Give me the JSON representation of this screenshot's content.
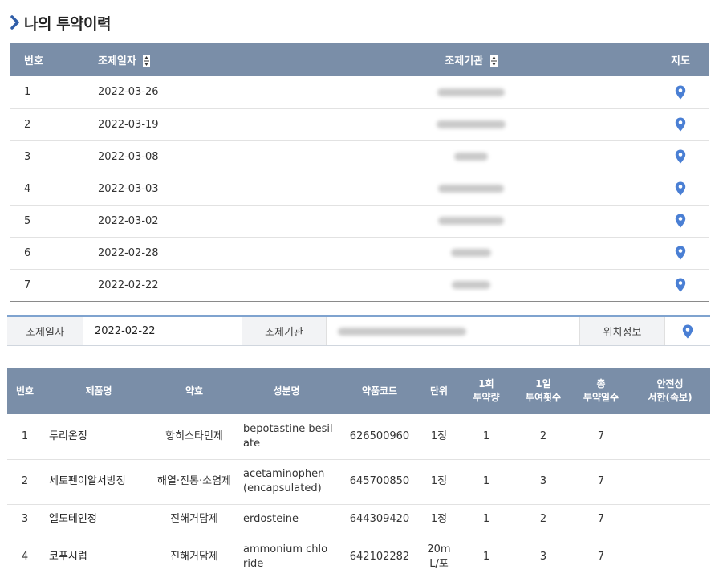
{
  "page": {
    "title": "나의 투약이력",
    "accent_color": "#7a8ea8",
    "pin_color": "#4a7fd4"
  },
  "history": {
    "headers": {
      "no": "번호",
      "date": "조제일자",
      "institution": "조제기관",
      "map": "지도"
    },
    "rows": [
      {
        "no": "1",
        "date": "2022-03-26"
      },
      {
        "no": "2",
        "date": "2022-03-19"
      },
      {
        "no": "3",
        "date": "2022-03-08"
      },
      {
        "no": "4",
        "date": "2022-03-03"
      },
      {
        "no": "5",
        "date": "2022-03-02"
      },
      {
        "no": "6",
        "date": "2022-02-28"
      },
      {
        "no": "7",
        "date": "2022-02-22"
      }
    ]
  },
  "detail": {
    "date_label": "조제일자",
    "date_value": "2022-02-22",
    "institution_label": "조제기관",
    "location_label": "위치정보"
  },
  "drugs": {
    "headers": {
      "no": "번호",
      "name": "제품명",
      "effect": "약효",
      "ingredient": "성분명",
      "code": "약품코드",
      "unit": "단위",
      "dose_line1": "1회",
      "dose_line2": "투약량",
      "freq_line1": "1일",
      "freq_line2": "투여횟수",
      "days_line1": "총",
      "days_line2": "투약일수",
      "safety_line1": "안전성",
      "safety_line2": "서한(속보)"
    },
    "rows": [
      {
        "no": "1",
        "name": "투리온정",
        "effect": "항히스타민제",
        "ingredient_l1": "bepotastine besil",
        "ingredient_l2": "ate",
        "code": "626500960",
        "unit_l1": "1정",
        "unit_l2": "",
        "dose": "1",
        "freq": "2",
        "days": "7"
      },
      {
        "no": "2",
        "name": "세토펜이알서방정",
        "effect": "해열·진통·소염제",
        "ingredient_l1": "acetaminophen",
        "ingredient_l2": "(encapsulated)",
        "code": "645700850",
        "unit_l1": "1정",
        "unit_l2": "",
        "dose": "1",
        "freq": "3",
        "days": "7"
      },
      {
        "no": "3",
        "name": "엘도테인정",
        "effect": "진해거담제",
        "ingredient_l1": "erdosteine",
        "ingredient_l2": "",
        "code": "644309420",
        "unit_l1": "1정",
        "unit_l2": "",
        "dose": "1",
        "freq": "2",
        "days": "7"
      },
      {
        "no": "4",
        "name": "코푸시럽",
        "effect": "진해거담제",
        "ingredient_l1": "ammonium chlo",
        "ingredient_l2": "ride",
        "code": "642102282",
        "unit_l1": "20m",
        "unit_l2": "L/포",
        "dose": "1",
        "freq": "3",
        "days": "7"
      }
    ]
  }
}
